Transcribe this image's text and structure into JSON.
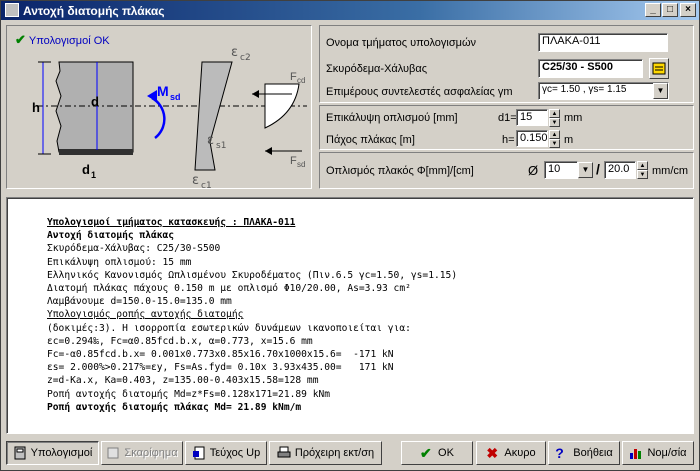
{
  "window": {
    "title": "Αντοχή διατομής πλάκας",
    "controls": [
      "_",
      "□",
      "×"
    ]
  },
  "diagram": {
    "status": "Υπολογισμοί ΟΚ",
    "labels": {
      "h": "h",
      "d": "d",
      "d1": "d",
      "d1_sub": "1",
      "msd": "M",
      "msd_sub": "sd",
      "ec2": "ε",
      "ec2_sub": "c2",
      "ec1": "ε",
      "ec1_sub": "c1",
      "es1": "ε",
      "es1_sub": "s1",
      "fcd": "F",
      "fcd_sub": "cd",
      "fsd": "F",
      "fsd_sub": "sd"
    }
  },
  "form": {
    "name_label": "Ονομα τμήματος υπολογισμών",
    "name_value": "ΠΛΑΚΑ-011",
    "material_label": "Σκυρόδεμα-Χάλυβας",
    "material_value": "C25/30 - S500",
    "safety_label": "Επιμέρους συντελεστές ασφαλείας γm",
    "safety_value": "γc= 1.50 , γs= 1.15",
    "cover_label": "Επικάλυψη οπλισμού [mm]",
    "cover_prefix": "d1=",
    "cover_value": "15",
    "cover_unit": "mm",
    "thickness_label": "Πάχος πλάκας [m]",
    "thickness_prefix": "h=",
    "thickness_value": "0.150",
    "thickness_unit": "m",
    "rebar_label": "Οπλισμός πλακός Φ[mm]/[cm]",
    "rebar_symbol": "Ø",
    "rebar_diameter": "10",
    "rebar_spacing": "20.0",
    "rebar_unit": "mm/cm"
  },
  "report": {
    "lines": [
      {
        "text": "Υπολογισμοί τμήματος κατασκευής : ΠΛΑΚΑ-011",
        "style": "u"
      },
      {
        "text": "Αντοχή διατομής πλάκας",
        "style": "b"
      },
      {
        "text": "Σκυρόδεμα-Χάλυβας: C25/30-S500",
        "style": ""
      },
      {
        "text": "Επικάλυψη οπλισμού: 15 mm",
        "style": ""
      },
      {
        "text": "Ελληνικός Κανονισμός Ωπλισμένου Σκυροδέματος (Πιν.6.5 γc=1.50, γs=1.15)",
        "style": ""
      },
      {
        "text": "Διατομή πλάκας πάχους 0.150 m με οπλισμό Φ10/20.00, As=3.93 cm²",
        "style": ""
      },
      {
        "text": "Λαμβάνουμε d=150.0-15.0=135.0 mm",
        "style": ""
      },
      {
        "text": "Υπολογισμός ροπής αντοχής διατομής",
        "style": "ul"
      },
      {
        "text": "(δοκιμές:3). Η ισορροπία εσωτερικών δυνάμεων ικανοποιείται για:",
        "style": ""
      },
      {
        "text": "εc=0.294‰, Fc=α0.85fcd.b.x, α=0.773, x=15.6 mm",
        "style": ""
      },
      {
        "text": "Fc=-α0.85fcd.b.x= 0.001x0.773x0.85x16.70x1000x15.6=  -171 kN",
        "style": ""
      },
      {
        "text": "εs= 2.000%>0.217%=εy, Fs=As.fyd= 0.10x 3.93x435.00=   171 kN",
        "style": ""
      },
      {
        "text": "z=d-Ka.x, Ka=0.403, z=135.00-0.403x15.58=128 mm",
        "style": ""
      },
      {
        "text": "Ροπή αντοχής διατομής Md=z*Fs=0.128x171=21.89 kNm",
        "style": ""
      },
      {
        "text": "Ροπή αντοχής διατομής πλάκας Md= 21.89 kNm/m",
        "style": "b"
      }
    ]
  },
  "buttons": {
    "calc": "Υπολογισμοί",
    "sketch": "Σκαρίφημα",
    "volume": "Τεύχος Up",
    "draft_print": "Πρόχειρη εκτ/ση",
    "ok": "OK",
    "cancel": "Ακυρο",
    "help": "Βοήθεια",
    "units": "Νομ/σία"
  },
  "colors": {
    "titlebar": "#0a246a",
    "status": "#0000c0",
    "arrow": "#0000ff",
    "face": "#d4d0c8"
  }
}
